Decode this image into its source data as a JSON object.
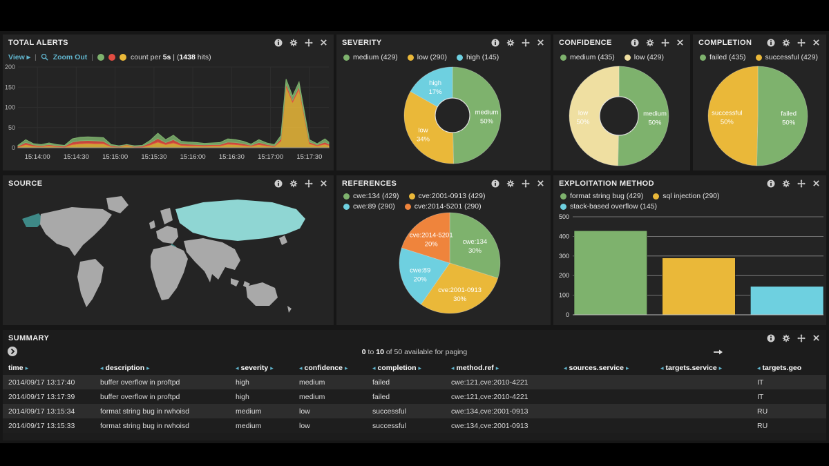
{
  "panels": {
    "total_alerts": {
      "title": "TOTAL ALERTS",
      "toolbar": {
        "view": "View",
        "view_caret": "▸",
        "zoom_out": "Zoom Out",
        "sep": "|",
        "count_pre": "count per ",
        "interval": "5s",
        "count_mid": " | (",
        "hits": "1438",
        "count_post": " hits)"
      }
    },
    "severity": {
      "title": "SEVERITY"
    },
    "confidence": {
      "title": "CONFIDENCE"
    },
    "completion": {
      "title": "COMPLETION"
    },
    "source": {
      "title": "SOURCE",
      "map": {
        "land_color": "#a9a9a9",
        "highlights": [
          {
            "name": "Russia",
            "color": "#8fd6d3"
          },
          {
            "name": "Alaska / United States",
            "color": "#3e8987"
          },
          {
            "name": "Italy",
            "color": "#3e8987"
          }
        ]
      }
    },
    "references": {
      "title": "REFERENCES"
    },
    "exploitation": {
      "title": "EXPLOITATION METHOD"
    }
  },
  "chart_data": [
    {
      "type": "area",
      "title": "TOTAL ALERTS",
      "stacked": true,
      "interval": "5s",
      "hits": 1438,
      "x_domain": [
        0,
        240
      ],
      "x_seconds": [
        0,
        6,
        12,
        18,
        24,
        30,
        36,
        42,
        48,
        54,
        60,
        66,
        72,
        78,
        84,
        90,
        96,
        102,
        108,
        114,
        120,
        126,
        132,
        138,
        144,
        150,
        156,
        162,
        168,
        174,
        180,
        186,
        192,
        198,
        203,
        207,
        212,
        217,
        225,
        231,
        237,
        240
      ],
      "tick_seconds": [
        15,
        45,
        75,
        105,
        135,
        165,
        195,
        225
      ],
      "tick_labels": [
        "15:14:00",
        "15:14:30",
        "15:15:00",
        "15:15:30",
        "15:16:00",
        "15:16:30",
        "15:17:00",
        "15:17:30"
      ],
      "ylim": [
        0,
        200
      ],
      "yticks": [
        0,
        50,
        100,
        150,
        200
      ],
      "series": [
        {
          "name": "yellow",
          "color": "#EAB839",
          "values": [
            2,
            8,
            4,
            3,
            5,
            3,
            2,
            8,
            10,
            11,
            10,
            10,
            3,
            2,
            7,
            2,
            2,
            7,
            14,
            8,
            12,
            6,
            5,
            5,
            4,
            5,
            5,
            9,
            8,
            6,
            4,
            8,
            5,
            3,
            17,
            152,
            113,
            145,
            10,
            5,
            9,
            6
          ]
        },
        {
          "name": "red",
          "color": "#E24D42",
          "values": [
            2,
            5,
            3,
            2,
            3,
            2,
            2,
            6,
            7,
            7,
            7,
            6,
            2,
            1,
            1,
            1,
            2,
            5,
            9,
            5,
            8,
            4,
            4,
            3,
            3,
            3,
            3,
            5,
            5,
            4,
            2,
            5,
            3,
            2,
            5,
            6,
            5,
            6,
            4,
            2,
            5,
            3
          ]
        },
        {
          "name": "green",
          "color": "#7EB26D",
          "values": [
            2,
            7,
            3,
            3,
            4,
            3,
            2,
            8,
            9,
            9,
            9,
            9,
            3,
            2,
            0,
            2,
            2,
            6,
            13,
            7,
            11,
            6,
            5,
            5,
            4,
            4,
            5,
            8,
            7,
            6,
            3,
            7,
            4,
            3,
            8,
            12,
            10,
            12,
            6,
            3,
            8,
            5
          ]
        }
      ]
    },
    {
      "type": "pie",
      "title": "SEVERITY",
      "donut": true,
      "slices": [
        {
          "label": "medium",
          "count": 429,
          "pct": "50%",
          "color": "#7EB26D"
        },
        {
          "label": "low",
          "count": 290,
          "pct": "34%",
          "color": "#EAB839"
        },
        {
          "label": "high",
          "count": 145,
          "pct": "17%",
          "color": "#6ED0E0"
        }
      ]
    },
    {
      "type": "pie",
      "title": "CONFIDENCE",
      "donut": true,
      "slices": [
        {
          "label": "medium",
          "count": 435,
          "pct": "50%",
          "color": "#7EB26D"
        },
        {
          "label": "low",
          "count": 429,
          "pct": "50%",
          "color": "#EFDFA1"
        }
      ]
    },
    {
      "type": "pie",
      "title": "COMPLETION",
      "donut": false,
      "slices": [
        {
          "label": "failed",
          "count": 435,
          "pct": "50%",
          "color": "#7EB26D"
        },
        {
          "label": "successful",
          "count": 429,
          "pct": "50%",
          "color": "#EAB839"
        }
      ]
    },
    {
      "type": "pie",
      "title": "REFERENCES",
      "donut": false,
      "slices": [
        {
          "label": "cwe:134",
          "count": 429,
          "pct": "30%",
          "color": "#7EB26D"
        },
        {
          "label": "cve:2001-0913",
          "count": 429,
          "pct": "30%",
          "color": "#EAB839"
        },
        {
          "label": "cwe:89",
          "count": 290,
          "pct": "20%",
          "color": "#6ED0E0"
        },
        {
          "label": "cve:2014-5201",
          "count": 290,
          "pct": "20%",
          "color": "#EF843C"
        }
      ]
    },
    {
      "type": "bar",
      "title": "EXPLOITATION METHOD",
      "categories": [
        "format string bug",
        "sql injection",
        "stack-based overflow"
      ],
      "values": [
        429,
        290,
        145
      ],
      "colors": [
        "#7EB26D",
        "#EAB839",
        "#6ED0E0"
      ],
      "ylim": [
        0,
        500
      ],
      "yticks": [
        0,
        100,
        200,
        300,
        400,
        500
      ]
    }
  ],
  "summary": {
    "title": "SUMMARY",
    "arrow_left": "◂",
    "arrow_right": "▸",
    "paging": {
      "from": "0",
      "to_word": " to ",
      "to": "10",
      "rest": " of 50 available for paging"
    },
    "columns": [
      {
        "label": "time",
        "left": false,
        "right": true
      },
      {
        "label": "description",
        "left": true,
        "right": true
      },
      {
        "label": "severity",
        "left": true,
        "right": true
      },
      {
        "label": "confidence",
        "left": true,
        "right": true
      },
      {
        "label": "completion",
        "left": true,
        "right": true
      },
      {
        "label": "method.ref",
        "left": true,
        "right": true
      },
      {
        "label": "sources.service",
        "left": true,
        "right": true
      },
      {
        "label": "targets.service",
        "left": true,
        "right": true
      },
      {
        "label": "targets.geo",
        "left": true,
        "right": false
      }
    ],
    "rows": [
      [
        "2014/09/17 13:17:40",
        "buffer overflow in proftpd",
        "high",
        "medium",
        "failed",
        "cwe:121,cve:2010-4221",
        "",
        "",
        "IT"
      ],
      [
        "2014/09/17 13:17:39",
        "buffer overflow in proftpd",
        "high",
        "medium",
        "failed",
        "cwe:121,cve:2010-4221",
        "",
        "",
        "IT"
      ],
      [
        "2014/09/17 13:15:34",
        "format string bug in rwhoisd",
        "medium",
        "low",
        "successful",
        "cwe:134,cve:2001-0913",
        "",
        "",
        "RU"
      ],
      [
        "2014/09/17 13:15:33",
        "format string bug in rwhoisd",
        "medium",
        "low",
        "successful",
        "cwe:134,cve:2001-0913",
        "",
        "",
        "RU"
      ]
    ]
  }
}
